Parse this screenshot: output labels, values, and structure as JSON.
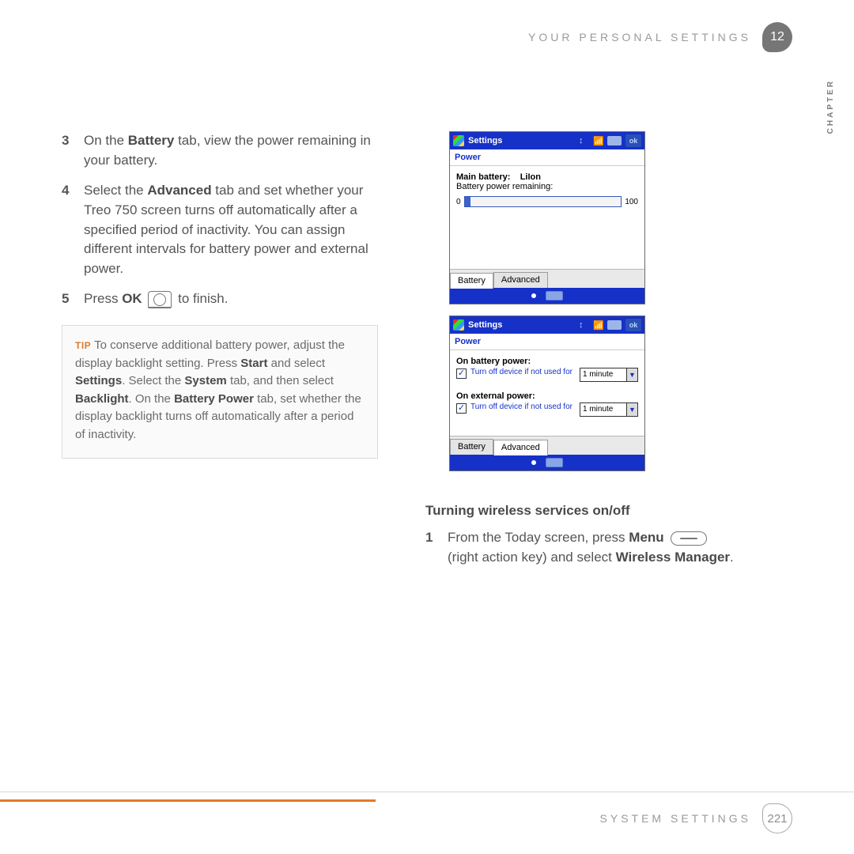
{
  "header": {
    "title": "YOUR PERSONAL SETTINGS",
    "chapter_number": "12",
    "chapter_label": "CHAPTER"
  },
  "left": {
    "steps": [
      {
        "n": "3",
        "prefix": "On the ",
        "bold1": "Battery",
        "after1": " tab, view the power remaining in your battery."
      },
      {
        "n": "4",
        "prefix": "Select the ",
        "bold1": "Advanced",
        "after1": " tab and set whether your Treo 750 screen turns off automatically after a specified period of inactivity. You can assign different intervals for battery power and external power."
      },
      {
        "n": "5",
        "prefix": "Press ",
        "bold1": "OK",
        "after1": " to finish."
      }
    ],
    "tip": {
      "label": "TIP",
      "text_parts": [
        " To conserve additional battery power, adjust the display backlight setting. Press ",
        "Start",
        " and select ",
        "Settings",
        ". Select the ",
        "System",
        " tab, and then select ",
        "Backlight",
        ". On the ",
        "Battery Power",
        " tab, set whether the display backlight turns off automatically after a period of inactivity."
      ]
    }
  },
  "shots": {
    "common": {
      "title": "Settings",
      "sub": "Power",
      "ok": "ok"
    },
    "battery": {
      "main_label": "Main battery:",
      "main_value": "LiIon",
      "remaining_label": "Battery power remaining:",
      "min": "0",
      "max": "100",
      "tabs": {
        "battery": "Battery",
        "advanced": "Advanced"
      }
    },
    "advanced": {
      "group1_hdr": "On battery power:",
      "group1_text": "Turn off device if not used for",
      "group1_value": "1 minute",
      "group2_hdr": "On external power:",
      "group2_text": "Turn off device if not used for",
      "group2_value": "1 minute",
      "tabs": {
        "battery": "Battery",
        "advanced": "Advanced"
      }
    }
  },
  "right": {
    "section_heading": "Turning wireless services on/off",
    "step": {
      "n": "1",
      "prefix": "From the Today screen, press ",
      "bold1": "Menu",
      "mid": " (right action key) and select ",
      "bold2": "Wireless Manager",
      "tail": "."
    }
  },
  "footer": {
    "label": "SYSTEM SETTINGS",
    "page": "221"
  }
}
